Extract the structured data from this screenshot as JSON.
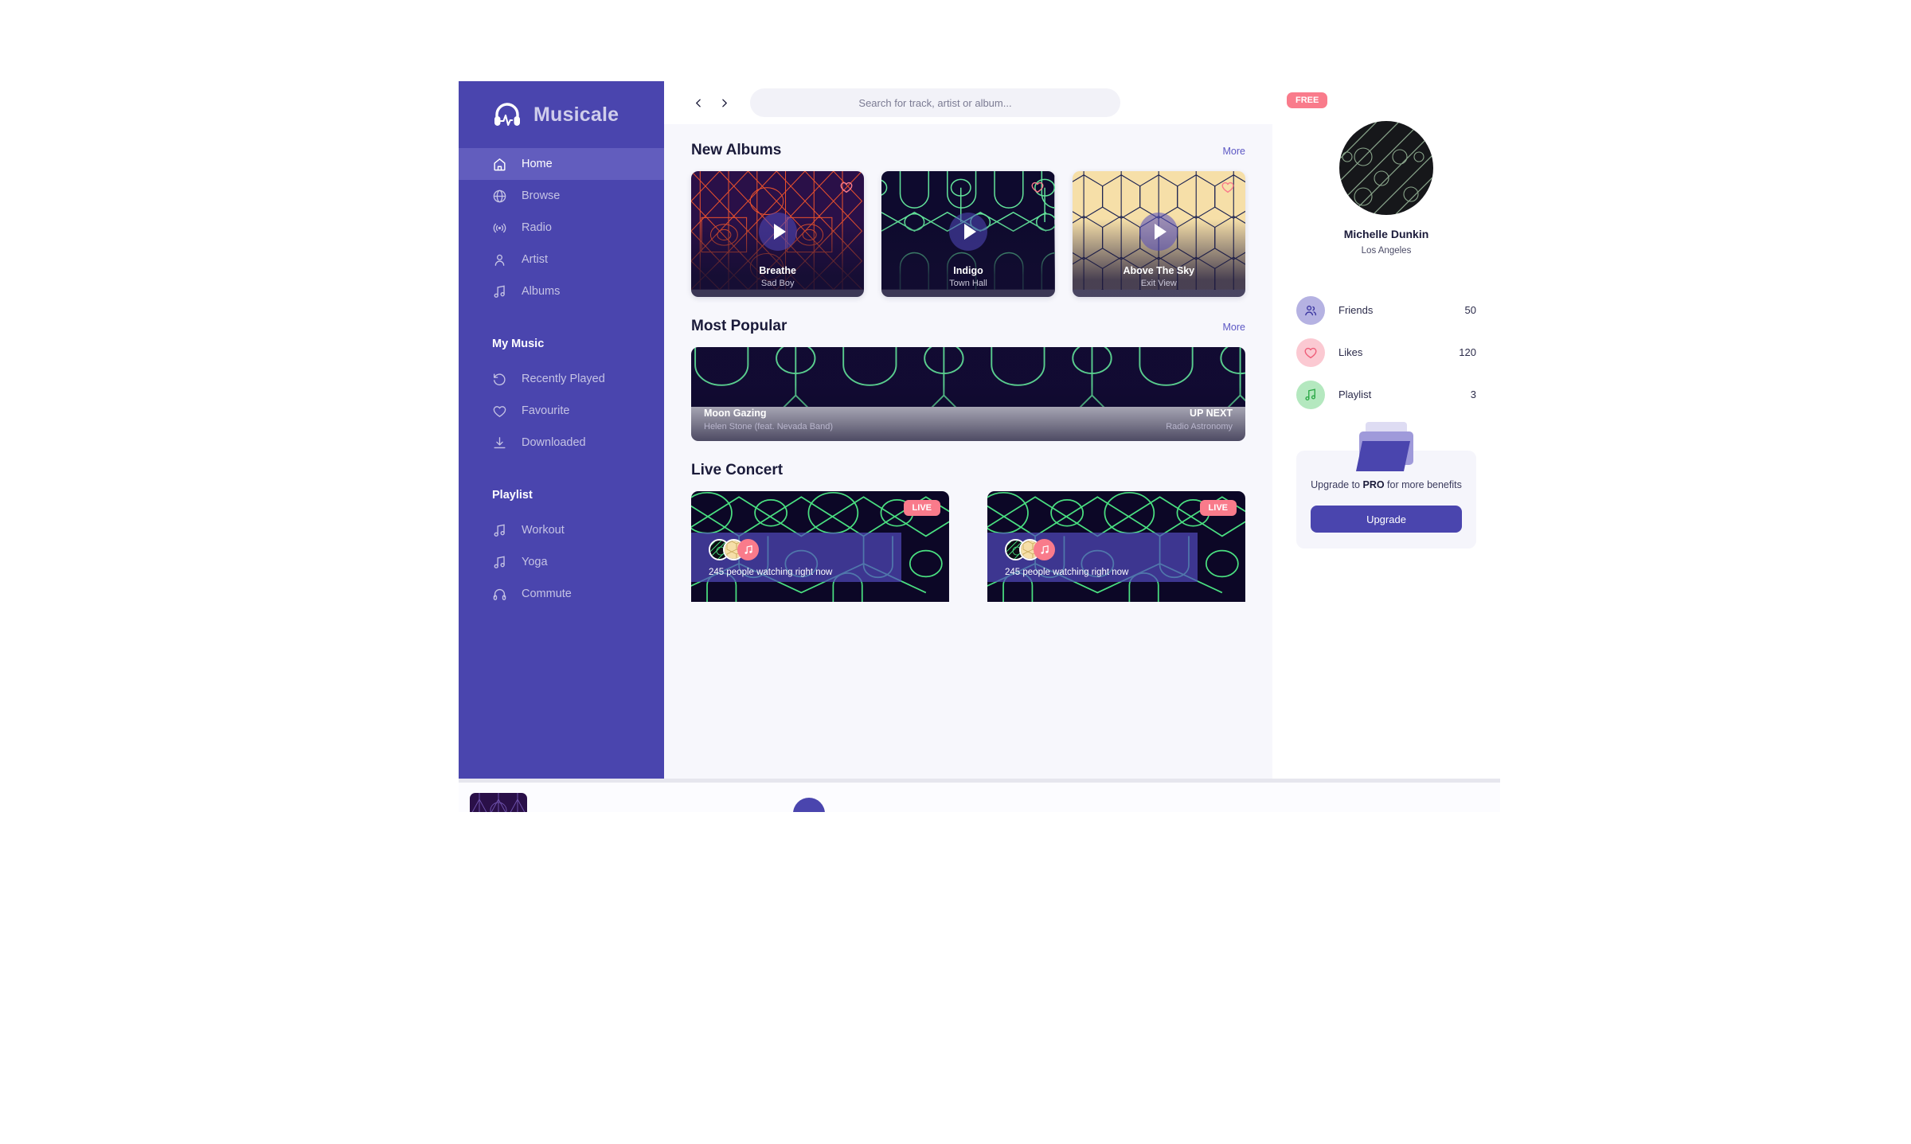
{
  "brand": {
    "name": "Musicale",
    "logo_icon": "headphones-waveform-icon"
  },
  "sidebar": {
    "main_items": [
      {
        "label": "Home",
        "icon": "home-icon",
        "active": true
      },
      {
        "label": "Browse",
        "icon": "globe-icon",
        "active": false
      },
      {
        "label": "Radio",
        "icon": "radio-wave-icon",
        "active": false
      },
      {
        "label": "Artist",
        "icon": "person-icon",
        "active": false
      },
      {
        "label": "Albums",
        "icon": "music-note-icon",
        "active": false
      }
    ],
    "my_music_title": "My Music",
    "my_music_items": [
      {
        "label": "Recently Played",
        "icon": "history-icon"
      },
      {
        "label": "Favourite",
        "icon": "heart-icon"
      },
      {
        "label": "Downloaded",
        "icon": "download-icon"
      }
    ],
    "playlist_title": "Playlist",
    "playlist_items": [
      {
        "label": "Workout",
        "icon": "music-note-icon"
      },
      {
        "label": "Yoga",
        "icon": "music-note-icon"
      },
      {
        "label": "Commute",
        "icon": "headphones-icon"
      }
    ]
  },
  "topbar": {
    "back_icon": "chevron-left-icon",
    "forward_icon": "chevron-right-icon",
    "search_placeholder": "Search for track, artist or album...",
    "search_value": "",
    "notification_icon": "bell-icon",
    "has_notification": true,
    "settings_icon": "gear-icon"
  },
  "sections": {
    "new_albums": {
      "title": "New Albums",
      "more_label": "More",
      "cards": [
        {
          "title": "Breathe",
          "artist": "Sad Boy",
          "heart_icon": "heart-icon",
          "play_icon": "play-icon",
          "art": "dark-purple-orange-geometric"
        },
        {
          "title": "Indigo",
          "artist": "Town Hall",
          "heart_icon": "heart-icon",
          "play_icon": "play-icon",
          "art": "dark-navy-green-geometric"
        },
        {
          "title": "Above The Sky",
          "artist": "Exit View",
          "heart_icon": "heart-icon",
          "play_icon": "play-icon",
          "art": "cream-navy-hexagon"
        }
      ]
    },
    "most_popular": {
      "title": "Most Popular",
      "more_label": "More",
      "track_title": "Moon Gazing",
      "track_artist": "Helen Stone (feat. Nevada Band)",
      "up_next_label": "UP NEXT",
      "up_next_title": "Radio Astronomy"
    },
    "live_concert": {
      "title": "Live Concert",
      "cards": [
        {
          "badge": "LIVE",
          "watching": "245 people watching right now"
        },
        {
          "badge": "LIVE",
          "watching": "245 people watching right now"
        }
      ]
    }
  },
  "profile": {
    "plan_badge": "FREE",
    "avatar_icon": "user-avatar",
    "name": "Michelle Dunkin",
    "location": "Los Angeles",
    "stats": [
      {
        "label": "Friends",
        "value": "50",
        "icon": "friends-icon"
      },
      {
        "label": "Likes",
        "value": "120",
        "icon": "heart-icon"
      },
      {
        "label": "Playlist",
        "value": "3",
        "icon": "music-note-icon"
      }
    ],
    "upgrade": {
      "illustration": "folder-icon",
      "text_before": "Upgrade to ",
      "text_bold": "PRO",
      "text_after": " for more benefits",
      "button_label": "Upgrade"
    }
  },
  "colors": {
    "sidebar": "#4a45ae",
    "accent": "#5c57c4",
    "pink": "#f97b8b",
    "bg": "#f7f7fc"
  }
}
